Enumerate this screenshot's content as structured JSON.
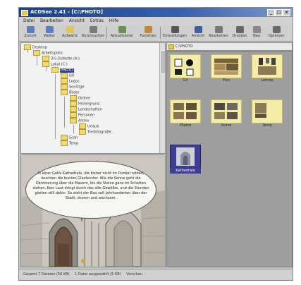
{
  "window": {
    "title": "ACDSee 2.41 - [C:\\PHOTO]"
  },
  "menu": [
    "Datei",
    "Bearbeiten",
    "Ansicht",
    "Extras",
    "Hilfe"
  ],
  "toolbar": [
    {
      "label": "Zurück",
      "icon": "back-arrow-icon"
    },
    {
      "label": "Weiter",
      "icon": "forward-arrow-icon"
    },
    {
      "label": "Aufwärts",
      "icon": "up-folder-icon"
    },
    {
      "label": "Durchsuchen",
      "icon": "browse-icon"
    },
    {
      "label": "Aktualisieren",
      "icon": "refresh-icon"
    },
    {
      "label": "Favoriten",
      "icon": "favorites-icon"
    },
    {
      "label": "Einstellungen",
      "icon": "settings-icon"
    },
    {
      "label": "Ansicht",
      "icon": "view-icon"
    },
    {
      "label": "Bearbeiten",
      "icon": "edit-icon"
    },
    {
      "label": "Drucken",
      "icon": "print-icon"
    },
    {
      "label": "Neu",
      "icon": "new-icon"
    },
    {
      "label": "Optionen",
      "icon": "options-icon"
    }
  ],
  "tree": {
    "nodes": [
      {
        "label": "Desktop",
        "level": 0
      },
      {
        "label": "Arbeitsplatz",
        "level": 0
      },
      {
        "label": "3½-Diskette (A:)",
        "level": 1
      },
      {
        "label": "Lokal (C:)",
        "level": 1
      },
      {
        "label": "PHOTO",
        "level": 2,
        "selected": true
      },
      {
        "label": "Gif",
        "level": 3
      },
      {
        "label": "Logos",
        "level": 3
      },
      {
        "label": "Sonstige",
        "level": 3
      },
      {
        "label": "Bilder",
        "level": 3
      },
      {
        "label": "Ordner",
        "level": 4
      },
      {
        "label": "Hintergrund",
        "level": 4
      },
      {
        "label": "Landschaften",
        "level": 4
      },
      {
        "label": "Personen",
        "level": 4
      },
      {
        "label": "Archiv",
        "level": 4
      },
      {
        "label": "Urlaub",
        "level": 5
      },
      {
        "label": "Tierfotografie",
        "level": 5
      },
      {
        "label": "Scan",
        "level": 3
      },
      {
        "label": "Temp",
        "level": 3
      }
    ]
  },
  "preview": {
    "bubble_text": "In einer Gotik-Kathedrale, die bisher nicht im Dunkel ruhten, leuchten die bunten Glasfenster. Wie die Sonne geht die Dämmerung über die Mauern, bis die Steine ganz im Schatten stehen. Kein Laut dringt durch das alte Gewölbe, und die Stunden gleiten still dahin. So steht der Bau seit Jahrhunderten über der Stadt, stumm und wachsam."
  },
  "path": "C:\\PHOTO",
  "thumbnails": [
    {
      "caption": "Gif",
      "selected": false
    },
    {
      "caption": "Pics",
      "selected": false
    },
    {
      "caption": "Lettres",
      "selected": false
    },
    {
      "caption": "Photos",
      "selected": false
    },
    {
      "caption": "Scans",
      "selected": false
    },
    {
      "caption": "Temp",
      "selected": false
    },
    {
      "caption": "Kathedrale",
      "selected": true
    }
  ],
  "status": {
    "total": "Gesamt 7 Dateien (56 KB)",
    "selected": "1 Datei ausgewählt (5 KB)",
    "mode": "Vorschau"
  }
}
